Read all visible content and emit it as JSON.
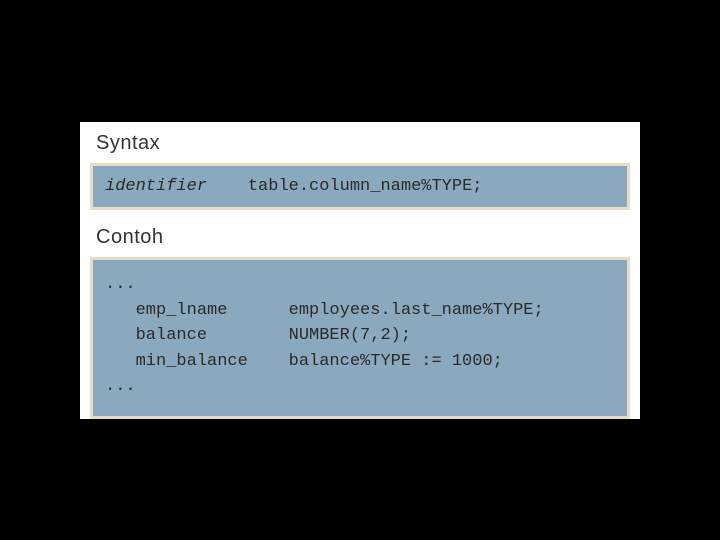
{
  "labels": {
    "syntax": "Syntax",
    "example": "Contoh"
  },
  "syntax_box": {
    "line1_identifier": "identifier",
    "line1_rest": "    table.column_name%TYPE;"
  },
  "example_box": {
    "l1": "...",
    "l2": "   emp_lname      employees.last_name%TYPE;",
    "l3": "   balance        NUMBER(7,2);",
    "l4": "   min_balance    balance%TYPE := 1000;",
    "l5": "..."
  }
}
